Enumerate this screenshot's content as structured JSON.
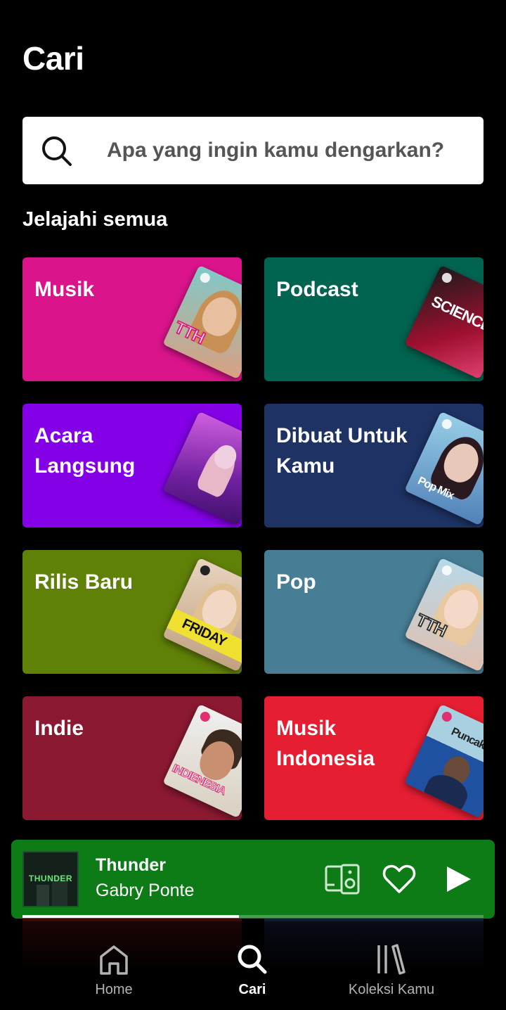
{
  "header": {
    "title": "Cari"
  },
  "search": {
    "placeholder": "Apa yang ingin kamu dengarkan?"
  },
  "browse": {
    "title": "Jelajahi semua",
    "categories": [
      {
        "label": "Musik",
        "color": "#dc148c",
        "art": "Today's Top Hits",
        "art_text": "TTH"
      },
      {
        "label": "Podcast",
        "color": "#006450",
        "art": "Science Vs",
        "art_text": "SCIENCE VS"
      },
      {
        "label": "Acara Langsung",
        "color": "#8400e7",
        "art": "Live concert"
      },
      {
        "label": "Dibuat Untuk Kamu",
        "color": "#1e3264",
        "art": "Pop Mix",
        "art_text": "Pop Mix"
      },
      {
        "label": "Rilis Baru",
        "color": "#608108",
        "art": "New Music Friday",
        "art_text": "FRIDAY"
      },
      {
        "label": "Pop",
        "color": "#477d95",
        "art": "Today's Top Hits",
        "art_text": "TTH"
      },
      {
        "label": "Indie",
        "color": "#8c1932",
        "art": "Indienesia",
        "art_text": "INDIENESIA"
      },
      {
        "label": "Musik Indonesia",
        "color": "#e61e32",
        "art": "Puncak Klasemen",
        "art_text": "Puncak Klasemen"
      }
    ]
  },
  "player": {
    "title": "Thunder",
    "artist": "Gabry Ponte",
    "cover_text": "THUNDER",
    "progress": 0.47,
    "accent": "#0d7c17"
  },
  "nav": {
    "items": [
      {
        "label": "Home",
        "icon": "home-icon",
        "active": false
      },
      {
        "label": "Cari",
        "icon": "search-icon",
        "active": true
      },
      {
        "label": "Koleksi Kamu",
        "icon": "library-icon",
        "active": false
      }
    ]
  }
}
